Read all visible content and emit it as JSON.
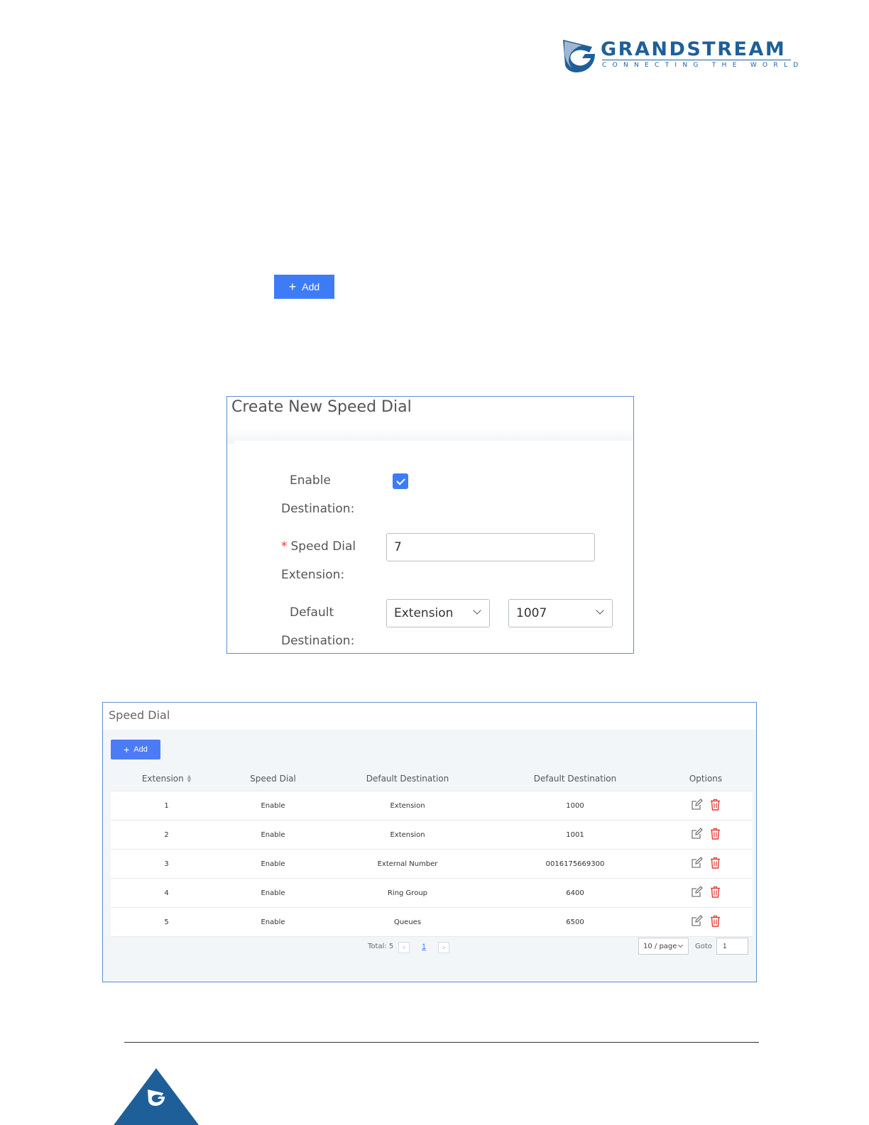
{
  "header": {
    "brand": "GRANDSTREAM",
    "tagline": "CONNECTING THE WORLD",
    "colors": {
      "brand": "#1f5f99",
      "accent": "#3d7cf6"
    }
  },
  "standalone_button": {
    "icon": "plus-icon",
    "label": "Add"
  },
  "create_dialog": {
    "title": "Create New Speed Dial",
    "enable_label_line1": "Enable",
    "enable_label_line2": "Destination",
    "enable_checked": true,
    "speed_dial_label_line1": "Speed Dial",
    "speed_dial_label_line2": "Extension",
    "speed_dial_required": "*",
    "speed_dial_value": "7",
    "default_dest_label_line1": "Default",
    "default_dest_label_line2": "Destination",
    "dest_type_value": "Extension",
    "dest_value": "1007",
    "colon": ":"
  },
  "speed_dial_panel": {
    "title": "Speed Dial",
    "add_label": "Add",
    "columns": [
      "Extension",
      "Speed Dial",
      "Default Destination",
      "Default Destination",
      "Options"
    ],
    "rows": [
      {
        "extension": "1",
        "speed_dial": "Enable",
        "dest_type": "Extension",
        "dest": "1000"
      },
      {
        "extension": "2",
        "speed_dial": "Enable",
        "dest_type": "Extension",
        "dest": "1001"
      },
      {
        "extension": "3",
        "speed_dial": "Enable",
        "dest_type": "External Number",
        "dest": "0016175669300"
      },
      {
        "extension": "4",
        "speed_dial": "Enable",
        "dest_type": "Ring Group",
        "dest": "6400"
      },
      {
        "extension": "5",
        "speed_dial": "Enable",
        "dest_type": "Queues",
        "dest": "6500"
      }
    ],
    "pagination": {
      "total": "Total: 5",
      "prev": "<",
      "current_page": "1",
      "next": ">",
      "page_size": "10 / page",
      "goto_label": "Goto",
      "goto_value": "1"
    },
    "option_icons": [
      "edit-icon",
      "delete-icon"
    ],
    "colors": {
      "delete": "#e53935",
      "edit": "#777777"
    }
  }
}
